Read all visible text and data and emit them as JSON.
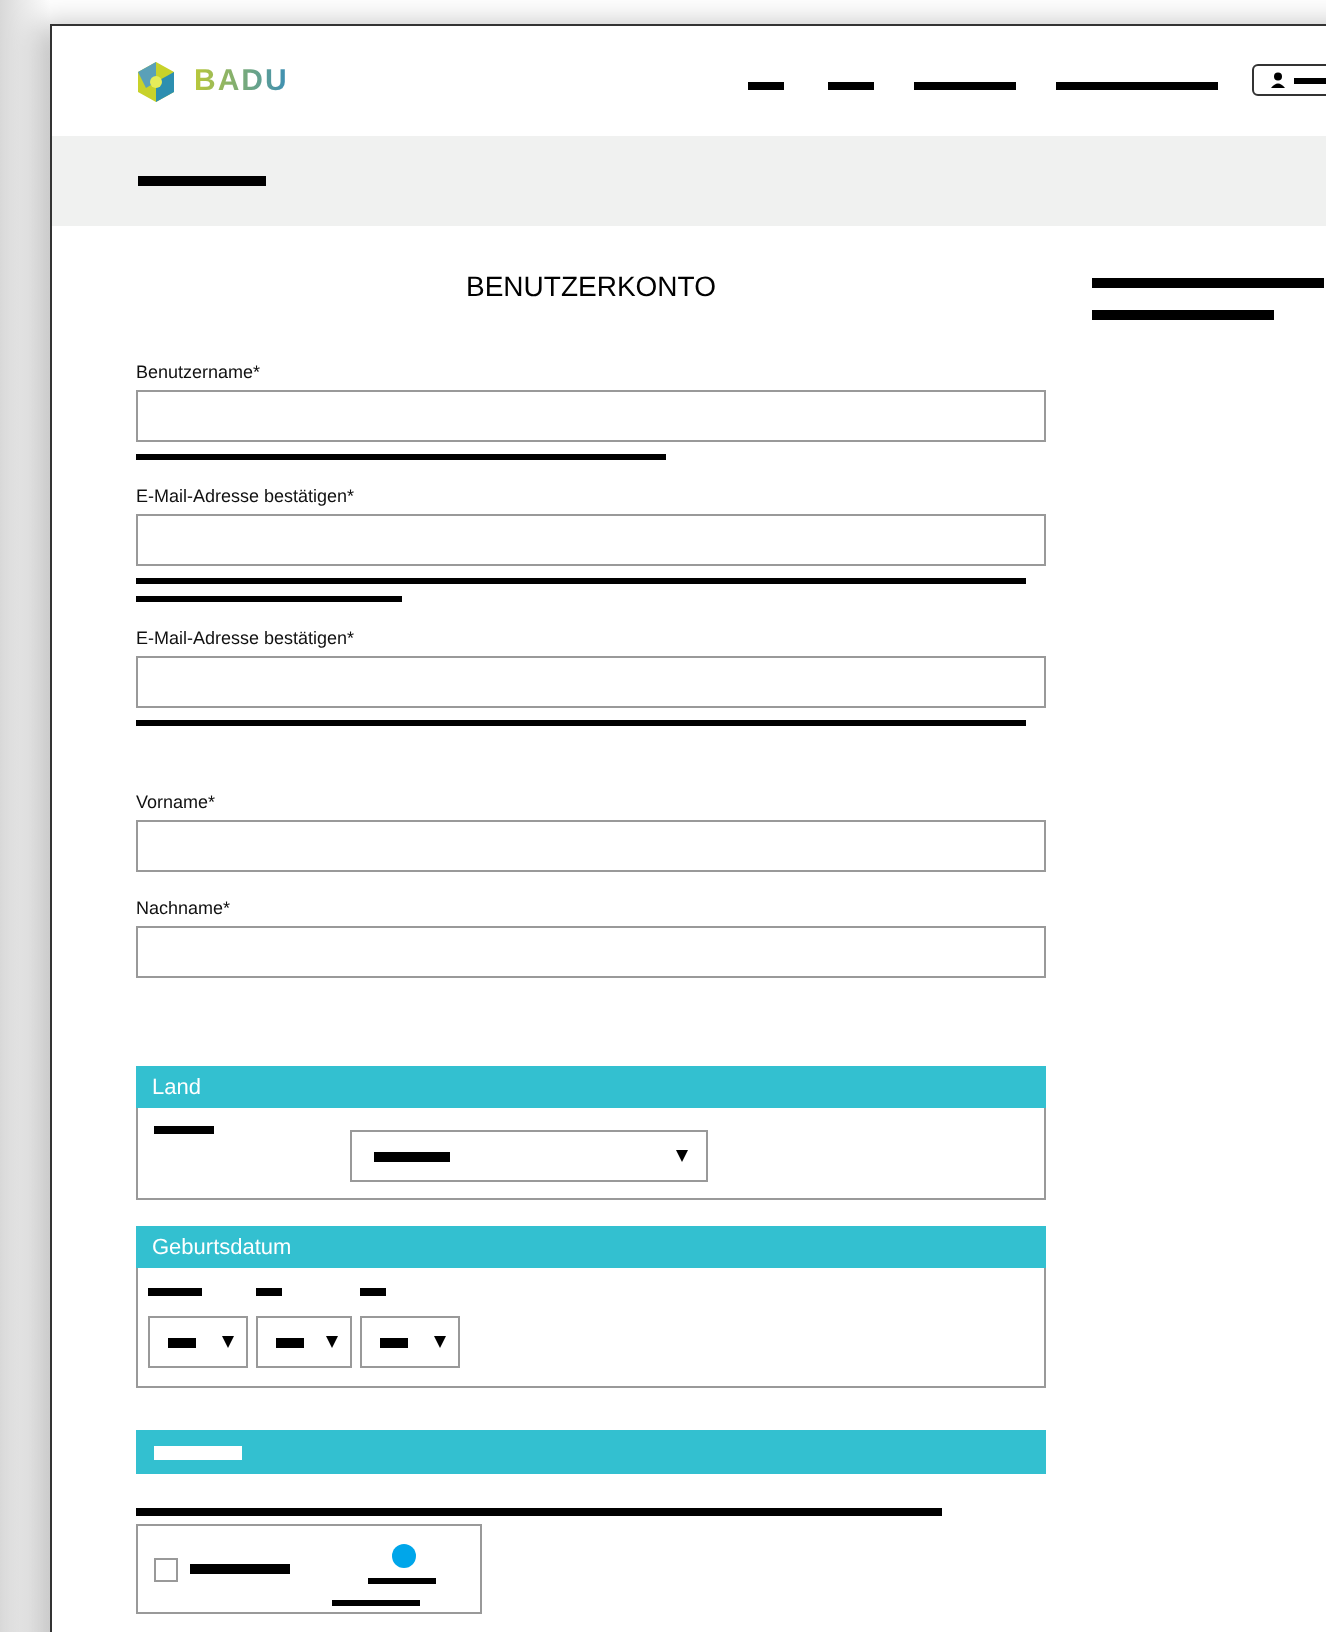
{
  "header": {
    "logo_text": "BADU"
  },
  "title": "BENUTZERKONTO",
  "fields": [
    {
      "label": "Benutzername*"
    },
    {
      "label": "E-Mail-Adresse bestätigen*"
    },
    {
      "label": "E-Mail-Adresse bestätigen*"
    },
    {
      "label": "Vorname*"
    },
    {
      "label": "Nachname*"
    }
  ],
  "sections": [
    {
      "kind": "country",
      "title": "Land"
    },
    {
      "kind": "date",
      "title": "Geburtsdatum"
    }
  ],
  "consent": {
    "checked": false
  }
}
